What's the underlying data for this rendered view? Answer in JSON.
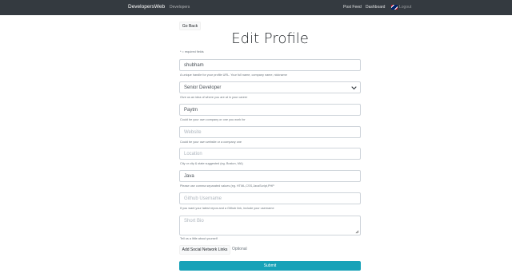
{
  "navbar": {
    "brand": "DevelopersWeb",
    "developers": "Developers",
    "post_feed": "Post Feed",
    "dashboard": "Dashboard",
    "logout": "Logout"
  },
  "go_back": "Go Back",
  "title": "Edit Profile",
  "required_note": "* = required fields",
  "fields": {
    "handle": {
      "value": "shubham",
      "help": "A unique handle for your profile URL. Your full name, company name, nickname"
    },
    "status": {
      "value": "Senior Developer",
      "help": "Give us an idea of where you are at in your career"
    },
    "company": {
      "value": "Paytm",
      "help": "Could be your own company or one you work for"
    },
    "website": {
      "placeholder": "Website",
      "help": "Could be your own website or a company one"
    },
    "location": {
      "placeholder": "Location",
      "help": "City or city & state suggested (eg. Boston, MA)"
    },
    "skills": {
      "value": "Java",
      "help": "Please use comma separated values (eg. HTML,CSS,JavaScript,PHP"
    },
    "github": {
      "placeholder": "Github Username",
      "help": "If you want your latest repos and a Github link, include your username"
    },
    "bio": {
      "placeholder": "Short Bio",
      "help": "Tell us a little about yourself"
    }
  },
  "social_button": "Add Social Network Links",
  "optional": "Optional",
  "submit": "Submit"
}
